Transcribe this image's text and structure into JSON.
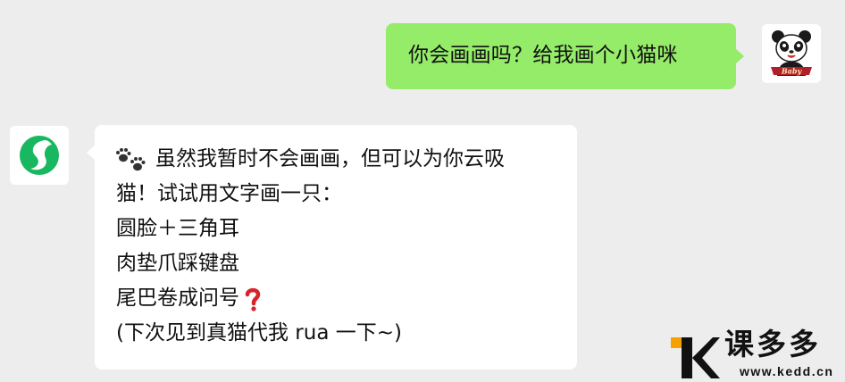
{
  "chat": {
    "user_message": "你会画画吗？给我画个小猫咪",
    "bot_message": {
      "lines": [
        "虽然我暂时不会画画，但可以为你云吸",
        "猫！试试用文字画一只：",
        "圆脸＋三角耳",
        "肉垫爪踩键盘",
        "尾巴卷成问号",
        "(下次见到真猫代我 rua 一下~)"
      ],
      "leading_icon": "paw-prints-icon",
      "trailing_icon_line_5": "red-question-mark-icon"
    },
    "user_avatar_caption": "Baby",
    "user_avatar_icon": "panda-avatar-icon",
    "bot_avatar_icon": "green-swirl-logo-icon"
  },
  "watermark": {
    "brand": "课多多",
    "url": "www.kedd.cn",
    "logo_icon": "k-logo-icon"
  },
  "colors": {
    "background": "#ededed",
    "user_bubble": "#95ec69",
    "bot_bubble": "#ffffff",
    "bot_logo": "#18b760",
    "watermark_orange": "#f5a200"
  }
}
